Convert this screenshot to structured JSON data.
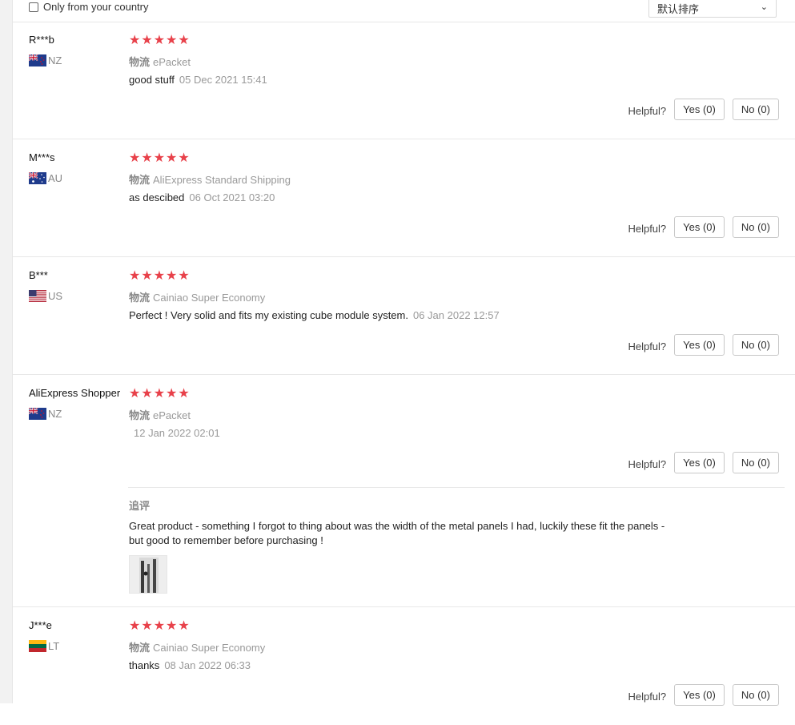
{
  "filter": {
    "only_country_label": "Only from your country"
  },
  "sort": {
    "selected": "默认排序"
  },
  "helpful_label": "Helpful?",
  "logistics_label": "物流",
  "followup_label": "追评",
  "reviews": [
    {
      "user": "R***b",
      "country": "NZ",
      "stars": "★★★★★",
      "logistics": "ePacket",
      "text": "good stuff",
      "date": "05 Dec 2021 15:41",
      "yes": "Yes (0)",
      "no": "No (0)"
    },
    {
      "user": "M***s",
      "country": "AU",
      "stars": "★★★★★",
      "logistics": "AliExpress Standard Shipping",
      "text": "as descibed",
      "date": "06 Oct 2021 03:20",
      "yes": "Yes (0)",
      "no": "No (0)"
    },
    {
      "user": "B***",
      "country": "US",
      "stars": "★★★★★",
      "logistics": "Cainiao Super Economy",
      "text": "Perfect ! Very solid and fits my existing cube module system.",
      "date": "06 Jan 2022 12:57",
      "yes": "Yes (0)",
      "no": "No (0)"
    },
    {
      "user": "AliExpress Shopper",
      "country": "NZ",
      "stars": "★★★★★",
      "logistics": "ePacket",
      "text": "",
      "date": "12 Jan 2022 02:01",
      "yes": "Yes (0)",
      "no": "No (0)",
      "followup_text": "Great product - something I forgot to thing about was the width of the metal panels I had, luckily these fit the panels - but good to remember before purchasing !"
    },
    {
      "user": "J***e",
      "country": "LT",
      "stars": "★★★★★",
      "logistics": "Cainiao Super Economy",
      "text": "thanks",
      "date": "08 Jan 2022 06:33",
      "yes": "Yes (0)",
      "no": "No (0)"
    }
  ],
  "colors": {
    "star": "#e8414a",
    "muted": "#999999",
    "divider": "#e8e8e8"
  }
}
